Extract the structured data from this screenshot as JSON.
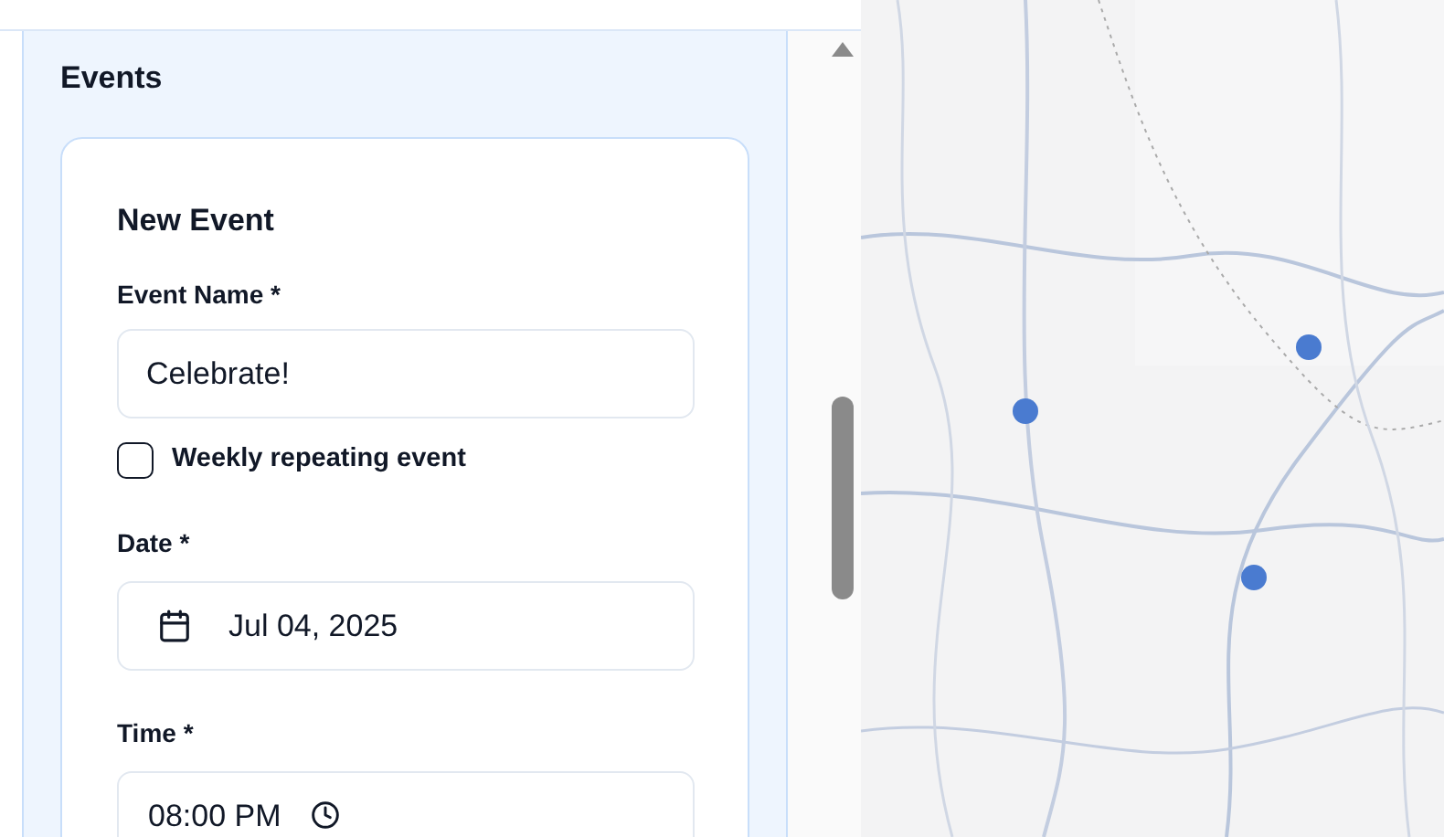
{
  "panel": {
    "title": "Events"
  },
  "form": {
    "title": "New Event",
    "fields": [
      {
        "kind": "text",
        "label": "Event Name *",
        "value": "Celebrate!"
      },
      {
        "kind": "checkbox",
        "label": "Weekly repeating event",
        "checked": false
      },
      {
        "kind": "date",
        "label": "Date *",
        "value": "Jul 04, 2025"
      },
      {
        "kind": "time",
        "label": "Time *",
        "value": "08:00 PM"
      }
    ]
  }
}
